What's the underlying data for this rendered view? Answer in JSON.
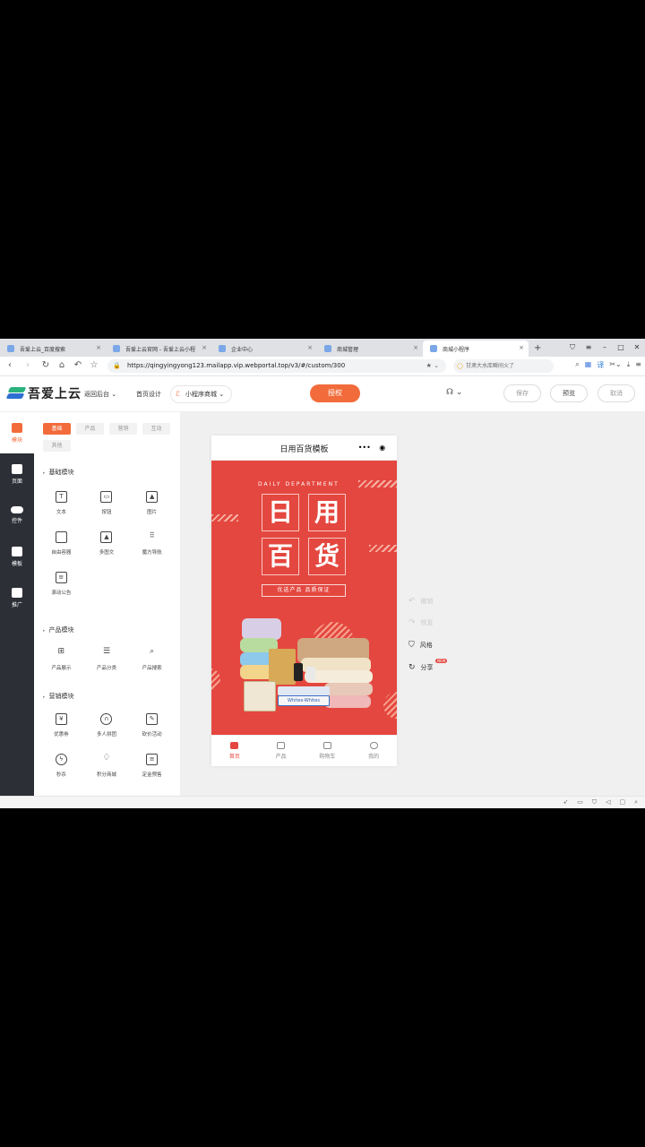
{
  "browser": {
    "tabs": [
      {
        "title": "吾爱上云_百度搜索",
        "active": false
      },
      {
        "title": "吾爱上云官网 - 吾爱上云小程",
        "active": false
      },
      {
        "title": "企业中心",
        "active": false
      },
      {
        "title": "商城管理",
        "active": false
      },
      {
        "title": "商城小程序",
        "active": true
      }
    ],
    "new_tab": "+",
    "url": "https://qingyingyong123.mailapp.vip.webportal.top/v3/#/custom/300",
    "search_box": "甘肃大水库瞬间火了",
    "icons": [
      "back-icon",
      "forward-icon",
      "reload-icon",
      "home-icon",
      "undo-icon",
      "star-icon"
    ]
  },
  "header": {
    "logo_text": "吾爱上云",
    "back_link": "返回后台",
    "homepage_design": "首页设计",
    "mini_program_select": "小程序商城",
    "authorize_button": "授权",
    "save_button": "保存",
    "preview_button": "预览",
    "cancel_button": "取消"
  },
  "sidebar": {
    "items": [
      {
        "label": "模块",
        "active": true
      },
      {
        "label": "页面",
        "active": false
      },
      {
        "label": "控件",
        "active": false
      },
      {
        "label": "模板",
        "active": false
      },
      {
        "label": "推广",
        "active": false
      }
    ]
  },
  "panel": {
    "filter_tabs": [
      "基础",
      "产品",
      "营销",
      "互动",
      "其他"
    ],
    "sections": [
      {
        "title": "基础模块",
        "items": [
          "文本",
          "按钮",
          "图片",
          "自由容器",
          "多图文",
          "魔方导航",
          "滚动公告"
        ]
      },
      {
        "title": "产品模块",
        "items": [
          "产品展示",
          "产品分类",
          "产品搜索"
        ]
      },
      {
        "title": "营销模块",
        "items": [
          "优惠券",
          "多人拼团",
          "砍价活动",
          "秒杀",
          "积分商城",
          "定金预售"
        ]
      }
    ]
  },
  "phone": {
    "title": "日用百货模板",
    "capsule_more": "•••",
    "banner": {
      "subtitle": "DAILY DEPARTMENT",
      "chars": [
        "日",
        "用",
        "百",
        "货"
      ],
      "slogan": "优选产品 品质保证",
      "product_label": "Whites-Whites"
    },
    "tabbar": [
      {
        "label": "首页",
        "active": true
      },
      {
        "label": "产品",
        "active": false
      },
      {
        "label": "购物车",
        "active": false
      },
      {
        "label": "我的",
        "active": false
      }
    ]
  },
  "actions": {
    "undo": "撤销",
    "redo": "恢复",
    "style": "风格",
    "share": "分享",
    "share_badge": "NEW"
  },
  "colors": {
    "accent": "#f26b3a",
    "banner_red": "#e4473f",
    "dark_sidebar": "#2c2f36"
  }
}
